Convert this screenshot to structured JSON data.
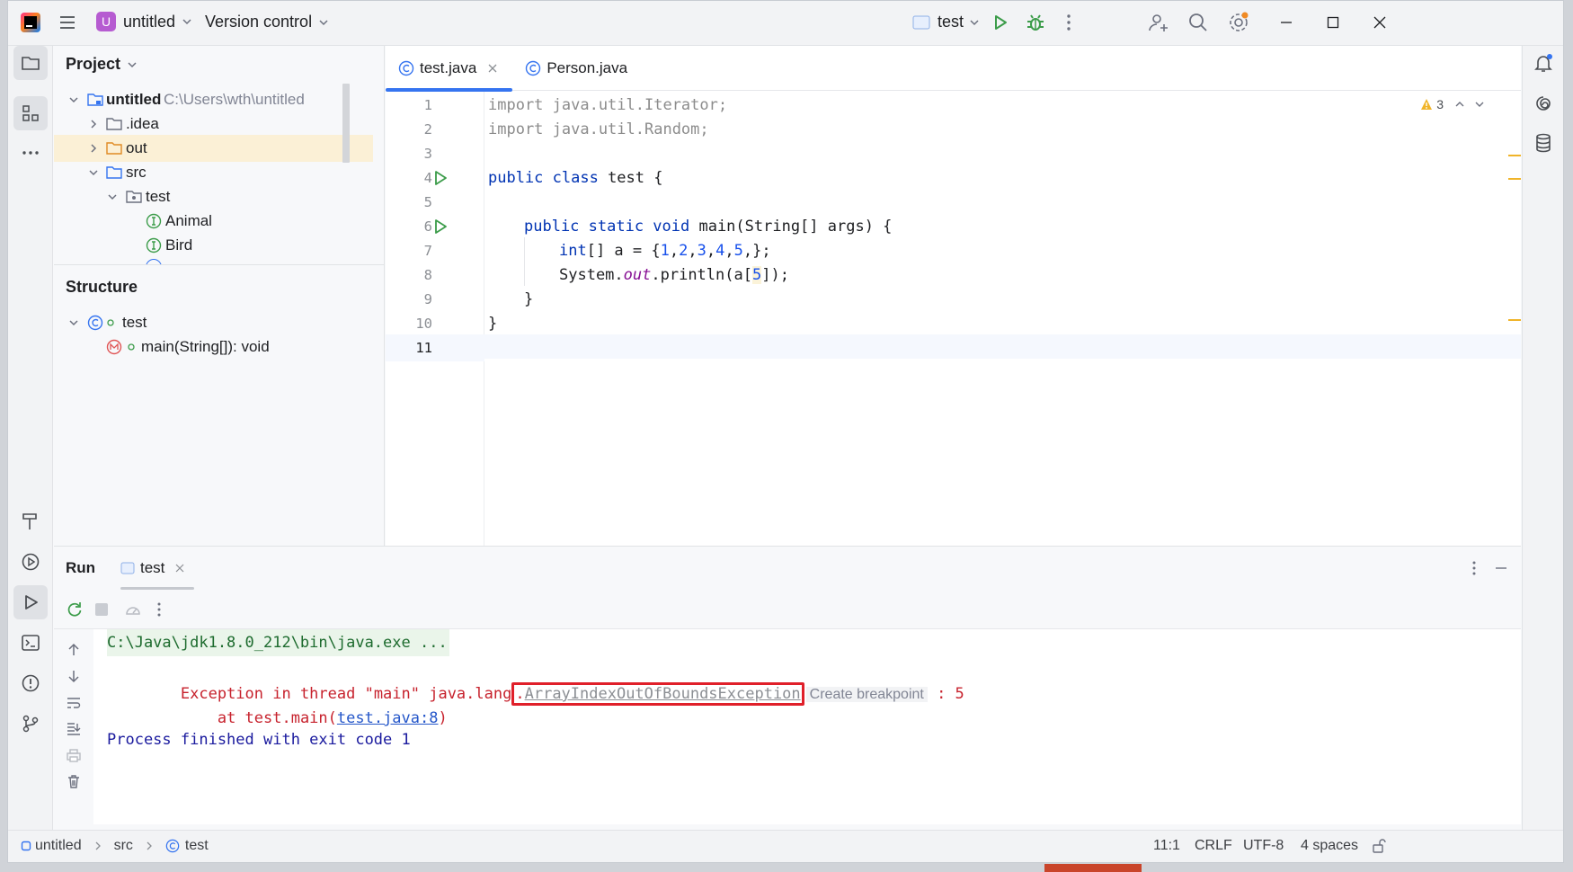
{
  "titlebar": {
    "project_badge": "U",
    "project_name": "untitled",
    "version_control": "Version control",
    "run_config": "test"
  },
  "project_panel": {
    "title": "Project",
    "tree": [
      {
        "label": "untitled",
        "path": "C:\\Users\\wth\\untitled"
      },
      {
        "label": ".idea"
      },
      {
        "label": "out"
      },
      {
        "label": "src"
      },
      {
        "label": "test"
      },
      {
        "label": "Animal"
      },
      {
        "label": "Bird"
      }
    ]
  },
  "structure_panel": {
    "title": "Structure",
    "items": [
      {
        "label": "test"
      },
      {
        "label": "main(String[]): void"
      }
    ]
  },
  "editor": {
    "tabs": [
      {
        "label": "test.java"
      },
      {
        "label": "Person.java"
      }
    ],
    "warnings_count": "3",
    "line_numbers": [
      "1",
      "2",
      "3",
      "4",
      "5",
      "6",
      "7",
      "8",
      "9",
      "10",
      "11"
    ],
    "code": {
      "l1": "import java.util.Iterator;",
      "l2": "import java.util.Random;",
      "l4_kw": "public class",
      "l4_rest": " test {",
      "l6_kw": "public static void",
      "l6_rest": " main(String[] args) {",
      "l7_kw": "int",
      "l7_a": "[] a = {",
      "l7_n1": "1",
      "l7_n2": "2",
      "l7_n3": "3",
      "l7_n4": "4",
      "l7_n5": "5",
      "l7_end": ",};",
      "l8_a": "System.",
      "l8_out": "out",
      "l8_b": ".println(a[",
      "l8_n": "5",
      "l8_c": "]);",
      "l9": "}",
      "l10": "}"
    }
  },
  "run_panel": {
    "title": "Run",
    "tab": "test",
    "console": {
      "cmd": "C:\\Java\\jdk1.8.0_212\\bin\\java.exe ...",
      "exc_prefix": "Exception in thread \"main\" java.lang",
      "exc_dot": ".",
      "exc_link": "ArrayIndexOutOfBoundsException",
      "create_breakpoint": "Create breakpoint",
      "exc_suffix": " : 5",
      "at_prefix": "    at test.main(",
      "at_link": "test.java:8",
      "at_suffix": ")",
      "finished": "Process finished with exit code 1"
    }
  },
  "statusbar": {
    "crumbs": [
      "untitled",
      "src",
      "test"
    ],
    "position": "11:1",
    "line_sep": "CRLF",
    "encoding": "UTF-8",
    "indent": "4 spaces"
  },
  "colors": {
    "accent": "#3574f0",
    "highlight_box": "#e0202a",
    "run_green": "#3c9c4a",
    "selected_row": "#fbf0d6"
  }
}
